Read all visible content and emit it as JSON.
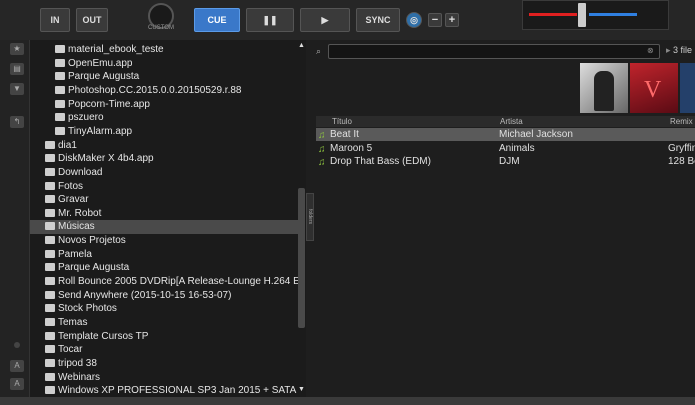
{
  "toolbar": {
    "in_label": "IN",
    "out_label": "OUT",
    "knob_label": "CUSTOM",
    "cue_label": "CUE",
    "pause_label": "❚❚",
    "play_label": "▶",
    "sync_label": "SYNC",
    "minus_label": "−",
    "plus_label": "+"
  },
  "mixer": {
    "left_color": "#e02020",
    "right_color": "#2f7fe0"
  },
  "tree": {
    "items": [
      {
        "label": "material_ebook_teste",
        "level": 2
      },
      {
        "label": "OpenEmu.app",
        "level": 2
      },
      {
        "label": "Parque Augusta",
        "level": 2
      },
      {
        "label": "Photoshop.CC.2015.0.0.20150529.r.88",
        "level": 2
      },
      {
        "label": "Popcorn-Time.app",
        "level": 2
      },
      {
        "label": "pszuero",
        "level": 2
      },
      {
        "label": "TinyAlarm.app",
        "level": 2
      },
      {
        "label": "dia1",
        "level": 1
      },
      {
        "label": "DiskMaker X 4b4.app",
        "level": 1
      },
      {
        "label": "Download",
        "level": 1
      },
      {
        "label": "Fotos",
        "level": 1
      },
      {
        "label": "Gravar",
        "level": 1
      },
      {
        "label": "Mr. Robot",
        "level": 1
      },
      {
        "label": "Músicas",
        "level": 1,
        "selected": true
      },
      {
        "label": "Novos Projetos",
        "level": 1
      },
      {
        "label": "Pamela",
        "level": 1
      },
      {
        "label": "Parque Augusta",
        "level": 1
      },
      {
        "label": "Roll Bounce 2005 DVDRip[A Release-Lounge H.264 E",
        "level": 1
      },
      {
        "label": "Send Anywhere (2015-10-15 16-53-07)",
        "level": 1
      },
      {
        "label": "Stock Photos",
        "level": 1
      },
      {
        "label": "Temas",
        "level": 1
      },
      {
        "label": "Template Cursos TP",
        "level": 1
      },
      {
        "label": "Tocar",
        "level": 1
      },
      {
        "label": "tripod 38",
        "level": 1
      },
      {
        "label": "Webinars",
        "level": 1
      },
      {
        "label": "Windows XP PROFESSIONAL SP3 Jan 2015 + SATA",
        "level": 1
      }
    ],
    "folders_tab": "folders"
  },
  "browser": {
    "search_value": "",
    "file_count": "3 file",
    "columns": {
      "title": "Título",
      "artist": "Artista",
      "remix": "Remix"
    },
    "rows": [
      {
        "title": "Beat It",
        "artist": "Michael Jackson",
        "remix": "",
        "selected": true
      },
      {
        "title": "Maroon 5",
        "artist": "Animals",
        "remix": "Gryffin"
      },
      {
        "title": "Drop That Bass (EDM)",
        "artist": "DJM",
        "remix": "128 Be"
      }
    ]
  }
}
